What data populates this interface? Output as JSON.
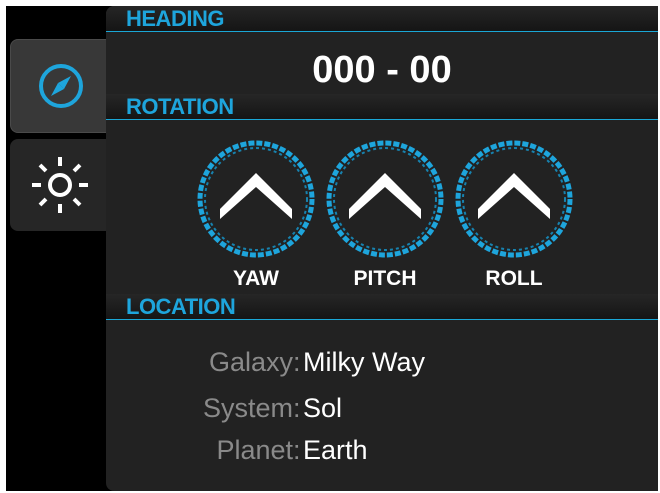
{
  "tabs": [
    {
      "name": "navigation",
      "icon": "compass-icon",
      "active": true
    },
    {
      "name": "settings",
      "icon": "sun-icon",
      "active": false
    }
  ],
  "heading": {
    "title": "HEADING",
    "value": "000 - 00"
  },
  "rotation": {
    "title": "ROTATION",
    "dials": [
      {
        "label": "YAW",
        "icon": "chevron-up-icon"
      },
      {
        "label": "PITCH",
        "icon": "chevron-up-icon"
      },
      {
        "label": "ROLL",
        "icon": "chevron-up-icon"
      }
    ]
  },
  "location": {
    "title": "LOCATION",
    "rows": [
      {
        "key": "Galaxy",
        "value": "Milky Way"
      },
      {
        "key": "System",
        "value": "Sol"
      },
      {
        "key": "Planet",
        "value": "Earth"
      }
    ]
  },
  "colors": {
    "accent": "#1ea5dc",
    "panel": "#222222",
    "background": "#000000",
    "label_gray": "#8a8a8a"
  }
}
